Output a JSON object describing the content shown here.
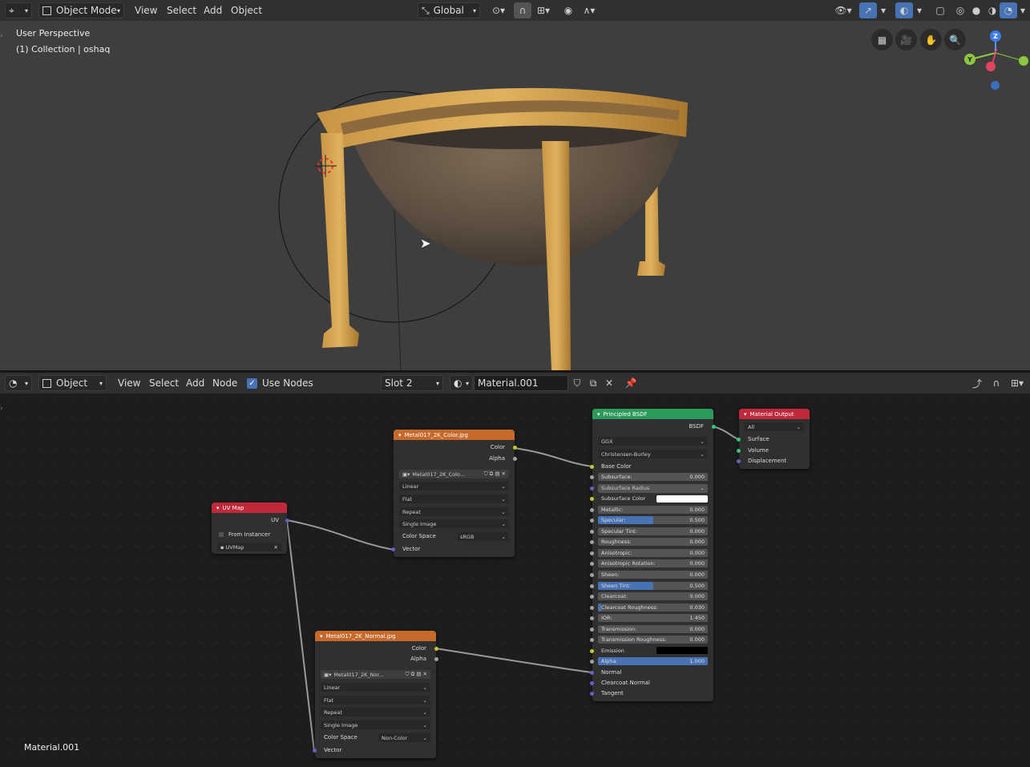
{
  "top_toolbar": {
    "mode": "Object Mode",
    "menus": [
      "View",
      "Select",
      "Add",
      "Object"
    ],
    "orientation": "Global"
  },
  "viewport": {
    "perspective": "User Perspective",
    "collection": "(1) Collection | oshaq",
    "gizmo_axes": {
      "z": "Z",
      "x": "X",
      "y": "Y"
    }
  },
  "node_toolbar": {
    "mode": "Object",
    "menus": [
      "View",
      "Select",
      "Add",
      "Node"
    ],
    "use_nodes": "Use Nodes",
    "slot": "Slot 2",
    "material": "Material.001"
  },
  "editor_footer": "Material.001",
  "nodes": {
    "uvmap": {
      "title": "UV Map",
      "out_uv": "UV",
      "from_instancer": "From Instancer",
      "uv_name": "UVMap"
    },
    "color_tex": {
      "title": "Metal017_2K_Color.jpg",
      "out_color": "Color",
      "out_alpha": "Alpha",
      "image": "Metal017_2K_Colo...",
      "interp": "Linear",
      "proj": "Flat",
      "ext": "Repeat",
      "source": "Single Image",
      "cs_label": "Color Space",
      "cs_value": "sRGB",
      "in_vector": "Vector"
    },
    "normal_tex": {
      "title": "Metal017_2K_Normal.jpg",
      "out_color": "Color",
      "out_alpha": "Alpha",
      "image": "Metal017_2K_Nor...",
      "interp": "Linear",
      "proj": "Flat",
      "ext": "Repeat",
      "source": "Single Image",
      "cs_label": "Color Space",
      "cs_value": "Non-Color",
      "in_vector": "Vector"
    },
    "bsdf": {
      "title": "Principled BSDF",
      "out": "BSDF",
      "distribution": "GGX",
      "subsurface_method": "Christensen-Burley",
      "base_color": "Base Color",
      "fields": [
        {
          "label": "Subsurface:",
          "value": "0.000",
          "fill": 0
        },
        {
          "label": "Subsurface Radius",
          "value": "",
          "fill": 0,
          "dropdown": true
        },
        {
          "label": "Subsurface Color",
          "value": "",
          "fill": 0,
          "swatch": "#ffffff"
        },
        {
          "label": "Metallic:",
          "value": "0.000",
          "fill": 0
        },
        {
          "label": "Specular:",
          "value": "0.500",
          "fill": 0.5
        },
        {
          "label": "Specular Tint:",
          "value": "0.000",
          "fill": 0
        },
        {
          "label": "Roughness:",
          "value": "0.000",
          "fill": 0
        },
        {
          "label": "Anisotropic:",
          "value": "0.000",
          "fill": 0
        },
        {
          "label": "Anisotropic Rotation:",
          "value": "0.000",
          "fill": 0
        },
        {
          "label": "Sheen:",
          "value": "0.000",
          "fill": 0
        },
        {
          "label": "Sheen Tint:",
          "value": "0.500",
          "fill": 0.5
        },
        {
          "label": "Clearcoat:",
          "value": "0.000",
          "fill": 0
        },
        {
          "label": "Clearcoat Roughness:",
          "value": "0.030",
          "fill": 0.03
        },
        {
          "label": "IOR:",
          "value": "1.450",
          "fill": 0
        },
        {
          "label": "Transmission:",
          "value": "0.000",
          "fill": 0
        },
        {
          "label": "Transmission Roughness:",
          "value": "0.000",
          "fill": 0
        },
        {
          "label": "Emission",
          "value": "",
          "fill": 0,
          "swatch": "#000000"
        },
        {
          "label": "Alpha:",
          "value": "1.000",
          "fill": 1
        }
      ],
      "normal": "Normal",
      "clearcoat_normal": "Clearcoat Normal",
      "tangent": "Tangent"
    },
    "output": {
      "title": "Material Output",
      "target": "All",
      "surface": "Surface",
      "volume": "Volume",
      "displacement": "Displacement"
    }
  },
  "colors": {
    "texture_header": "#c6692b",
    "uv_header": "#c1283a",
    "bsdf_header": "#2b9a5b",
    "output_header": "#c1283a",
    "accent": "#4772b3"
  }
}
